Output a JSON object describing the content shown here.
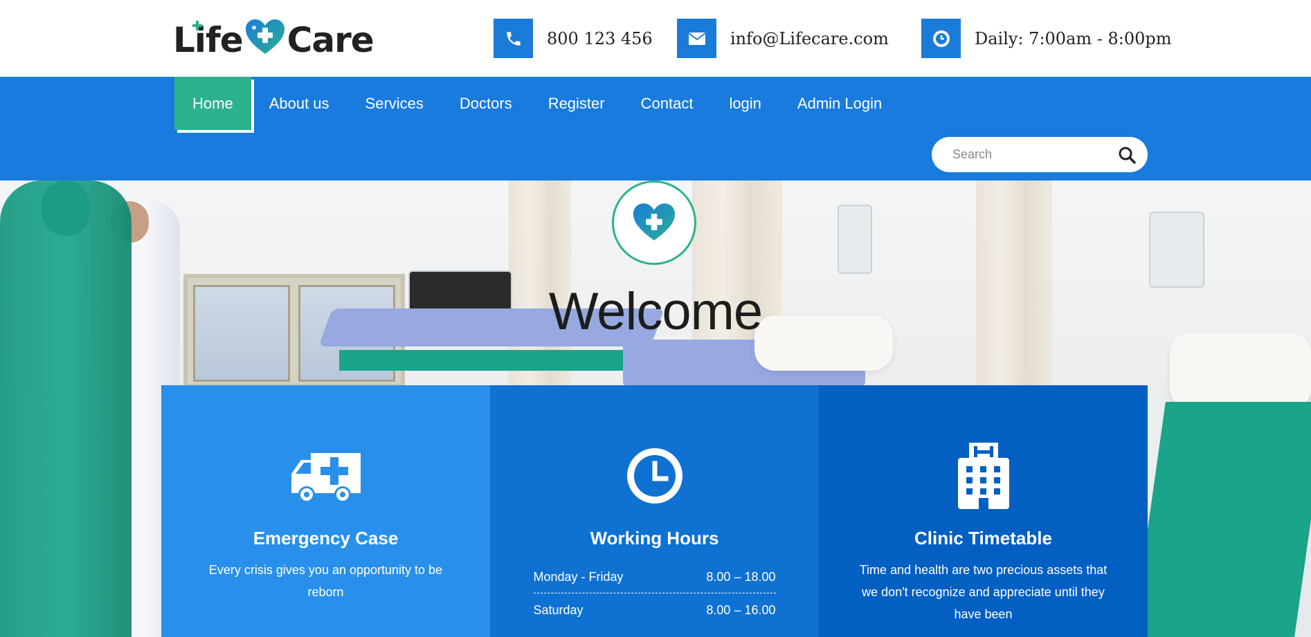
{
  "header": {
    "logo": {
      "part1": "Life",
      "part2": "Care"
    },
    "contacts": [
      {
        "icon": "phone-icon",
        "text": "800 123 456"
      },
      {
        "icon": "envelope-icon",
        "text": "info@Lifecare.com"
      },
      {
        "icon": "clock-icon",
        "text": "Daily: 7:00am - 8:00pm"
      }
    ]
  },
  "nav": {
    "items": [
      {
        "label": "Home",
        "active": true
      },
      {
        "label": "About us"
      },
      {
        "label": "Services"
      },
      {
        "label": "Doctors"
      },
      {
        "label": "Register"
      },
      {
        "label": "Contact"
      },
      {
        "label": "login"
      },
      {
        "label": "Admin Login"
      }
    ],
    "search": {
      "placeholder": "Search",
      "icon": "search-icon"
    }
  },
  "hero": {
    "badge_icon": "heart-cross-icon",
    "title": "Welcome"
  },
  "features": [
    {
      "icon": "ambulance-icon",
      "title": "Emergency Case",
      "text": "Every crisis gives you an opportunity to be reborn"
    },
    {
      "icon": "clock-icon",
      "title": "Working Hours",
      "hours": [
        {
          "days": "Monday - Friday",
          "time": "8.00 – 18.00"
        },
        {
          "days": "Saturday",
          "time": "8.00 – 16.00"
        }
      ]
    },
    {
      "icon": "hospital-icon",
      "title": "Clinic Timetable",
      "text": "Time and health are two precious assets that we don't recognize and appreciate until they have been"
    }
  ],
  "colors": {
    "primary_blue": "#187bdd",
    "accent_green": "#2cb18f",
    "feature_blue_1": "#2890ea",
    "feature_blue_2": "#0f71d2",
    "feature_blue_3": "#035fc2"
  }
}
